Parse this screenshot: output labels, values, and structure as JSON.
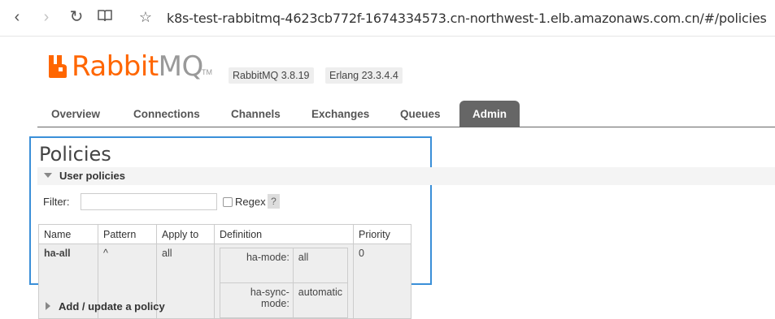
{
  "browser": {
    "url": "k8s-test-rabbitmq-4623cb772f-1674334573.cn-northwest-1.elb.amazonaws.com.cn/#/policies"
  },
  "header": {
    "logo_rabbit": "Rabbit",
    "logo_mq": "MQ",
    "logo_tm": "TM",
    "rabbitmq_version": "RabbitMQ 3.8.19",
    "erlang_version": "Erlang 23.3.4.4"
  },
  "tabs": [
    {
      "label": "Overview"
    },
    {
      "label": "Connections"
    },
    {
      "label": "Channels"
    },
    {
      "label": "Exchanges"
    },
    {
      "label": "Queues"
    },
    {
      "label": "Admin",
      "active": true
    }
  ],
  "page": {
    "title": "Policies",
    "section_label": "User policies",
    "filter_label": "Filter:",
    "filter_value": "",
    "regex_label": "Regex",
    "help_label": "?",
    "add_section_label": "Add / update a policy"
  },
  "table": {
    "columns": [
      "Name",
      "Pattern",
      "Apply to",
      "Definition",
      "Priority"
    ],
    "rows": [
      {
        "name": "ha-all",
        "pattern": "^",
        "apply_to": "all",
        "definition": [
          {
            "key": "ha-mode:",
            "value": "all"
          },
          {
            "key": "ha-sync-mode:",
            "value": "automatic"
          }
        ],
        "priority": "0"
      }
    ]
  },
  "colors": {
    "accent_orange": "#ff6600",
    "tab_active_bg": "#666666",
    "highlight_border": "#3a8fd8"
  }
}
